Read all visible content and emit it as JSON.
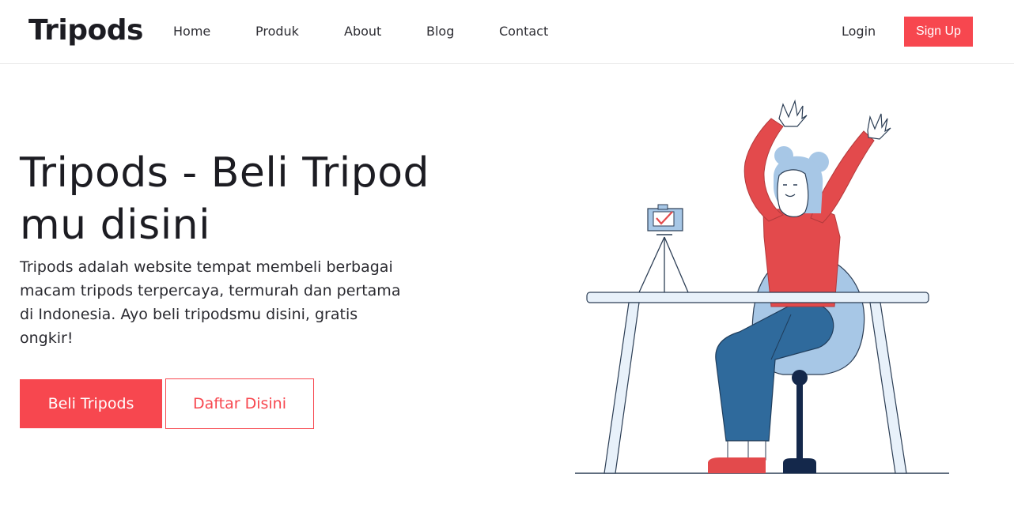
{
  "brand": "Tripods",
  "nav": {
    "items": [
      {
        "label": "Home"
      },
      {
        "label": "Produk"
      },
      {
        "label": "About"
      },
      {
        "label": "Blog"
      },
      {
        "label": "Contact"
      }
    ],
    "login_label": "Login",
    "signup_label": "Sign Up"
  },
  "hero": {
    "title": "Tripods - Beli Tripod mu disini",
    "description": "Tripods adalah website tempat membeli berbagai macam tripods terpercaya, termurah dan pertama di Indonesia. Ayo beli tripodsmu disini, gratis ongkir!",
    "primary_button": "Beli Tripods",
    "secondary_button": "Daftar Disini"
  },
  "colors": {
    "accent": "#f7474f",
    "text": "#1c1c22",
    "illustration_red": "#e34a4c",
    "illustration_blue": "#2f6a9c",
    "illustration_light_blue": "#a7c7e6",
    "illustration_navy": "#14284b"
  }
}
